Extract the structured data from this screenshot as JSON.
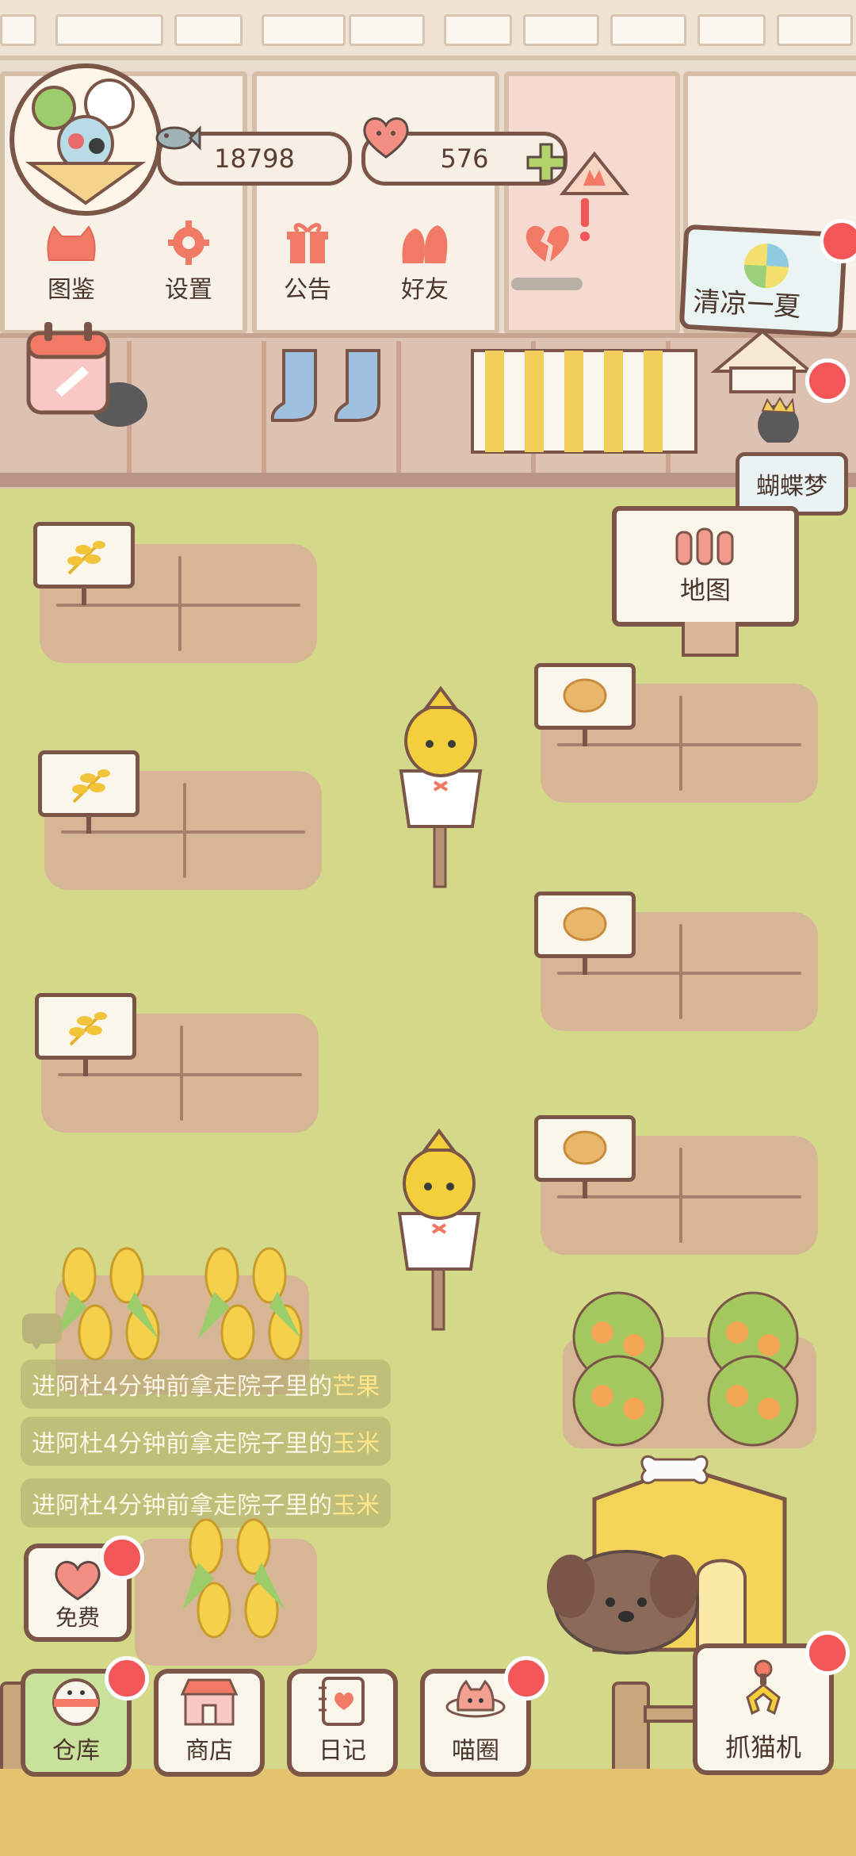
{
  "currencies": {
    "fish": {
      "icon": "fish-icon",
      "value": "18798"
    },
    "hearts": {
      "icon": "heart-icon",
      "value": "576",
      "add_icon": "plus-icon"
    }
  },
  "top_menu": [
    {
      "label": "图鉴",
      "icon": "cat-head-icon"
    },
    {
      "label": "设置",
      "icon": "gear-icon"
    },
    {
      "label": "公告",
      "icon": "gift-icon"
    },
    {
      "label": "好友",
      "icon": "friends-icon"
    }
  ],
  "event_badge": {
    "label": "清凉一夏"
  },
  "side_badge": {
    "label": "蝴蝶梦"
  },
  "map_sign": {
    "label": "地图"
  },
  "notices": [
    {
      "prefix": "进阿杜4分钟前拿走院子里的",
      "item": "芒果"
    },
    {
      "prefix": "进阿杜4分钟前拿走院子里的",
      "item": "玉米"
    },
    {
      "prefix": "进阿杜4分钟前拿走院子里的",
      "item": "玉米"
    }
  ],
  "free_button": {
    "label": "免费"
  },
  "bottom_nav": [
    {
      "label": "仓库",
      "icon": "storage-icon"
    },
    {
      "label": "商店",
      "icon": "shop-icon"
    },
    {
      "label": "日记",
      "icon": "diary-icon"
    },
    {
      "label": "喵圈",
      "icon": "cat-planet-icon"
    }
  ],
  "catch_machine": {
    "label": "抓猫机",
    "icon": "claw-icon"
  },
  "colors": {
    "accent_red": "#f25656",
    "outline": "#7a5548",
    "grass": "#d4d98a",
    "soil": "#d7b696"
  }
}
